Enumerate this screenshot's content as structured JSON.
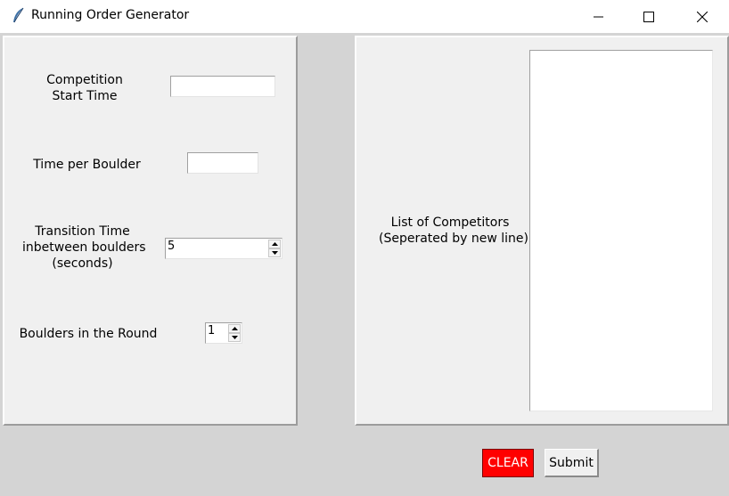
{
  "window": {
    "title": "Running Order Generator",
    "icon": "feather-icon",
    "controls": [
      "minimize-icon",
      "maximize-icon",
      "close-icon"
    ]
  },
  "form": {
    "start_time_label_line1": "Competition",
    "start_time_label_line2": "Start Time",
    "start_time_value": "",
    "time_per_boulder_label": "Time per Boulder",
    "time_per_boulder_value": "",
    "transition_label_line1": "Transition Time",
    "transition_label_line2": "inbetween boulders",
    "transition_label_line3": "(seconds)",
    "transition_value": "5",
    "boulders_label": "Boulders in the Round",
    "boulders_value": "1"
  },
  "competitors": {
    "label_line1": "List of Competitors",
    "label_line2": "(Seperated by new line)",
    "text": ""
  },
  "actions": {
    "clear_label": "CLEAR",
    "submit_label": "Submit"
  },
  "colors": {
    "clear_bg": "#ff0000",
    "clear_fg": "#ffffff",
    "panel_bg": "#f0f0f0",
    "window_bg": "#d4d4d4"
  }
}
